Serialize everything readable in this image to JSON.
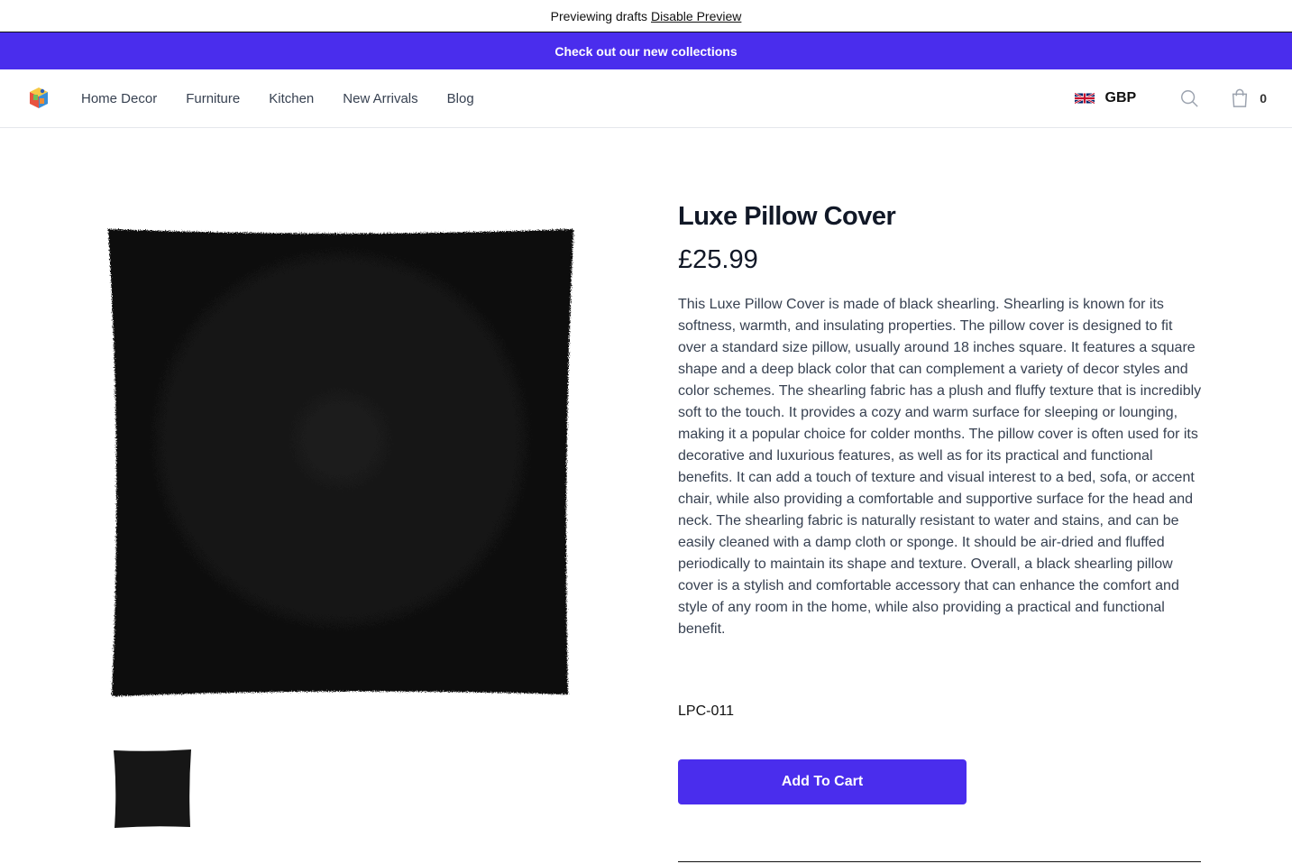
{
  "preview": {
    "text": "Previewing drafts",
    "link": "Disable Preview"
  },
  "promo": {
    "text": "Check out our new collections"
  },
  "nav": {
    "links": [
      "Home Decor",
      "Furniture",
      "Kitchen",
      "New Arrivals",
      "Blog"
    ],
    "currency": "GBP",
    "cart_count": "0"
  },
  "product": {
    "title": "Luxe Pillow Cover",
    "price": "£25.99",
    "description": "This Luxe Pillow Cover is made of black shearling. Shearling is known for its softness, warmth, and insulating properties. The pillow cover is designed to fit over a standard size pillow, usually around 18 inches square. It features a square shape and a deep black color that can complement a variety of decor styles and color schemes. The shearling fabric has a plush and fluffy texture that is incredibly soft to the touch. It provides a cozy and warm surface for sleeping or lounging, making it a popular choice for colder months. The pillow cover is often used for its decorative and luxurious features, as well as for its practical and functional benefits. It can add a touch of texture and visual interest to a bed, sofa, or accent chair, while also providing a comfortable and supportive surface for the head and neck. The shearling fabric is naturally resistant to water and stains, and can be easily cleaned with a damp cloth or sponge. It should be air-dried and fluffed periodically to maintain its shape and texture. Overall, a black shearling pillow cover is a stylish and comfortable accessory that can enhance the comfort and style of any room in the home, while also providing a practical and functional benefit.",
    "sku": "LPC-011",
    "add_to_cart": "Add To Cart"
  },
  "colors": {
    "accent": "#4a2ded",
    "pillow": "#141414"
  }
}
